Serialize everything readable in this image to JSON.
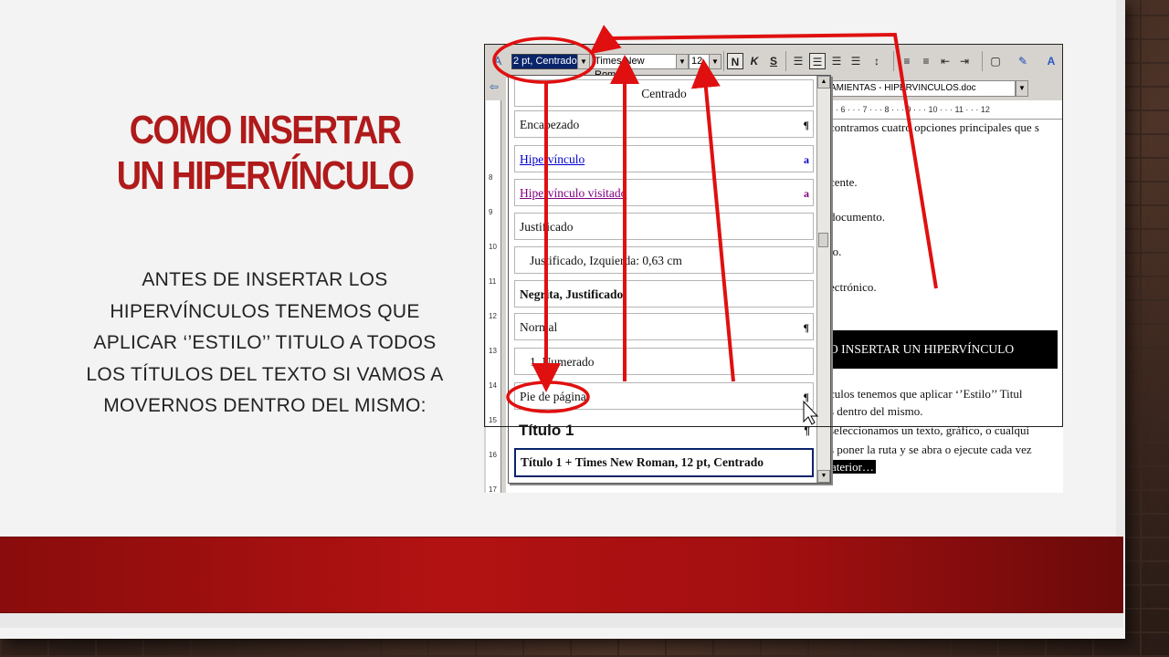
{
  "slide": {
    "title": "COMO INSERTAR UN HIPERVÍNCULO",
    "body": "ANTES DE INSERTAR LOS HIPERVÍNCULOS TENEMOS QUE APLICAR ‘’ESTILO’’ TITULO A TODOS LOS TÍTULOS DEL TEXTO SI VAMOS A MOVERNOS DENTRO DEL MISMO:"
  },
  "toolbar": {
    "style_value": "2 pt, Centrado",
    "font_value": "Times New Roman",
    "size_value": "12",
    "bold_label": "N",
    "italic_label": "K",
    "underline_label": "S"
  },
  "address": {
    "value": "AMIENTAS - HIPERVINCULOS.doc"
  },
  "ruler": {
    "h_marks": "· · · 6 · · · 7 · · · 8 · · · 9 · · · 10 · · · 11 · · · 12",
    "v_marks": [
      "8",
      "9",
      "10",
      "11",
      "12",
      "13",
      "14",
      "15",
      "16",
      "17"
    ]
  },
  "style_list": [
    {
      "label": "Centrado",
      "mark": ""
    },
    {
      "label": "Encabezado",
      "mark": "¶"
    },
    {
      "label": "Hipervínculo",
      "mark": "a"
    },
    {
      "label": "Hipervínculo visitado",
      "mark": "a"
    },
    {
      "label": "Justificado",
      "mark": ""
    },
    {
      "label": "Justificado, Izquierda: 0,63 cm",
      "mark": ""
    },
    {
      "label": "Negrita, Justificado",
      "mark": ""
    },
    {
      "label": "Normal",
      "mark": "¶"
    },
    {
      "label": "1. Numerado",
      "mark": ""
    },
    {
      "label": "Pie de página",
      "mark": "¶"
    },
    {
      "label": "Título 1",
      "mark": "¶"
    },
    {
      "label": "Título 1 + Times New Roman, 12 pt, Centrado",
      "mark": ""
    }
  ],
  "document": {
    "line1": "contramos cuatro opciones principales que s",
    "line2": "cente.",
    "line3": "documento.",
    "line4": "to.",
    "line5": "ectrónico.",
    "banner": "O INSERTAR UN HIPERVÍNCULO",
    "line6": "culos tenemos que aplicar ‘’Estilo’’ Titul",
    "line7": "s dentro del mismo.",
    "line8": "seleccionamos un texto, gráfico, o cualqui",
    "line9": "s poner la ruta y se abra o ejecute cada vez",
    "line10": "aterior…"
  },
  "colors": {
    "title_red": "#b01a1a",
    "bar_red": "#b31212",
    "annotation_red": "#e01010",
    "selection_blue": "#0a246a"
  }
}
